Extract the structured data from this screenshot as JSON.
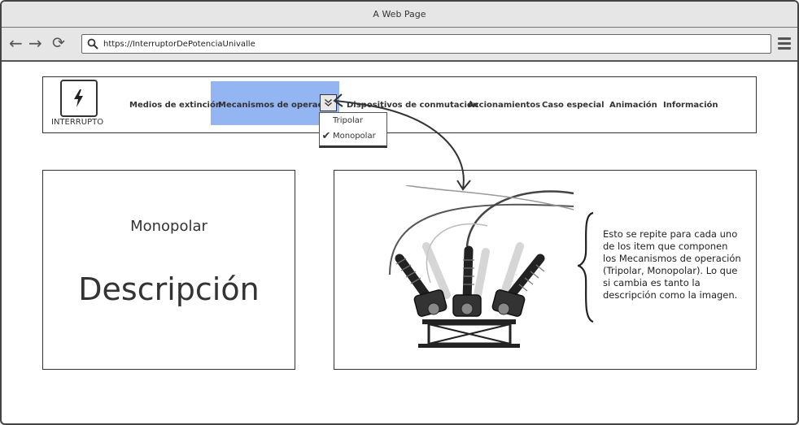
{
  "window": {
    "title": "A Web Page"
  },
  "browser": {
    "back_icon": "arrow-left",
    "forward_icon": "arrow-right",
    "reload_icon": "reload",
    "url": "https://InterruptorDePotenciaUnivalle",
    "menu_icon": "hamburger"
  },
  "logo": {
    "text": "INTERRUPTO",
    "icon": "lightning-bolt"
  },
  "nav": {
    "items": [
      "Medios de extinción",
      "Mecanismos de operación",
      "Dispositivos de conmutación",
      "Accionamientos",
      "Caso especial",
      "Animación",
      "Información"
    ],
    "active_color": "#93b5f2"
  },
  "dropdown": {
    "items": [
      {
        "label": "Tripolar",
        "checked": false
      },
      {
        "label": "Monopolar",
        "checked": true
      }
    ]
  },
  "left_panel": {
    "subtitle": "Monopolar",
    "title": "Descripción"
  },
  "right_panel": {
    "image": "high-voltage-circuit-breaker",
    "note": "Esto se repite para cada uno de los item que componen los Mecanismos de operación (Tripolar, Monopolar). Lo que si cambia es tanto la descripción como la imagen."
  }
}
